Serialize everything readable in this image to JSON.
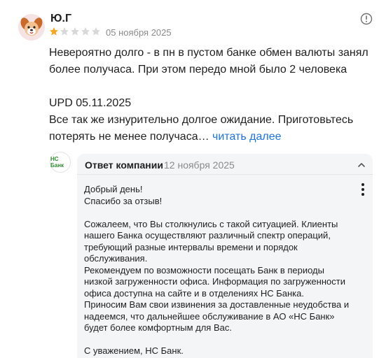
{
  "review": {
    "author": "Ю.Г",
    "rating": 1,
    "rating_max": 5,
    "date": "05 ноября 2025",
    "text_paragraph_1": "Невероятно долго - в пн в пустом банке обмен валюты занял более получаса. При этом передо мной было 2 человека",
    "text_update_title": "UPD 05.11.2025",
    "text_update_body": "Все так же изнурительно долгое ожидание. Приготовьтесь потерять не менее получаса…",
    "read_more_label": "читать далее"
  },
  "reply": {
    "logo_text": "НС Банк",
    "title": "Ответ компании",
    "date": "12 ноября 2025",
    "lines": [
      "Добрый день!",
      "Спасибо за отзыв!",
      "",
      "Сожалеем, что Вы столкнулись с такой ситуацией. Клиенты нашего Банка осуществляют различный спектр операций, требующий разные интервалы времени и порядок обслуживания.",
      "Рекомендуем по возможности посещать Банк в периоды низкой загруженности офиса. Информация по загруженности офиса доступна на сайте и в отделениях НС Банка.",
      "Приносим Вам свои извинения за доставленные неудобства и надеемся, что дальнейшее обслуживание в АО «НС Банк» будет более комфортным для Вас.",
      "",
      "С уважением, НС Банк."
    ]
  },
  "icons": {
    "avatar": "dog-avatar-icon",
    "info": "info-icon",
    "collapse": "chevron-up-icon",
    "menu": "more-vertical-icon"
  },
  "colors": {
    "star_filled": "#f5a623",
    "star_empty": "#d8d8d8",
    "link": "#1a73e8",
    "reply_bg": "#f4f5f6",
    "logo_green": "#2e8b2e"
  }
}
